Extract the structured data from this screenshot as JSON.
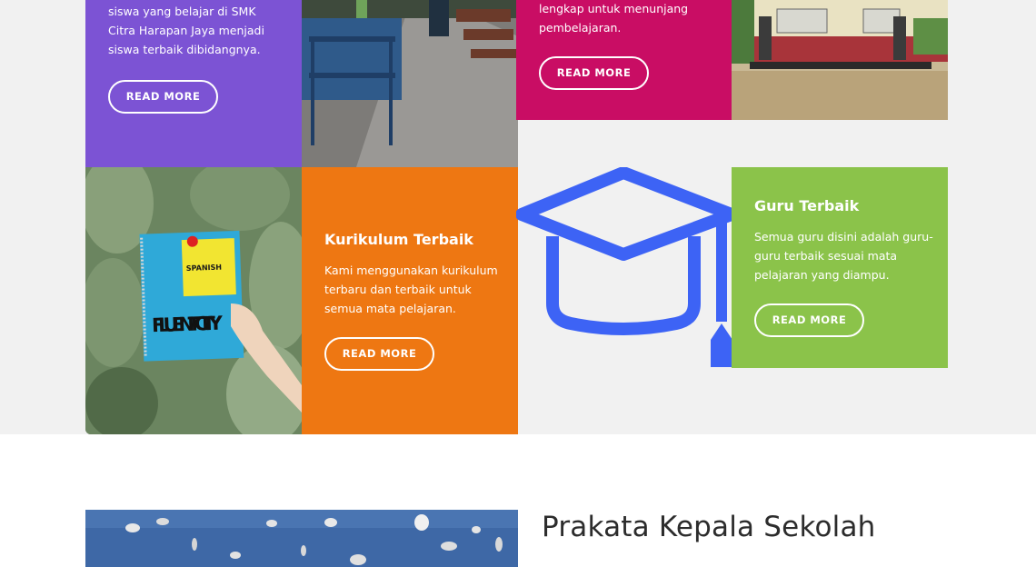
{
  "cards": {
    "prestasi": {
      "text": "siswa yang belajar di SMK Citra Harapan Jaya menjadi siswa terbaik dibidangnya.",
      "button": "READ MORE"
    },
    "fasilitas": {
      "text": "lengkap untuk menunjang pembelajaran.",
      "button": "READ MORE"
    },
    "kurikulum": {
      "title": "Kurikulum Terbaik",
      "text": "Kami menggunakan kurikulum terbaru dan terbaik untuk semua mata pelajaran.",
      "button": "READ MORE"
    },
    "guru": {
      "title": "Guru Terbaik",
      "text": "Semua guru disini adalah guru-guru terbaik sesuai mata pelajaran yang diampu.",
      "button": "READ MORE"
    }
  },
  "book": {
    "cover_small": "SPANISH",
    "cover_big": "FLUENT CITY"
  },
  "icons": {
    "graduation": "graduation-cap-icon"
  },
  "colors": {
    "purple": "#7c53d4",
    "magenta": "#c90d64",
    "orange": "#ee7712",
    "green": "#8bc34a",
    "icon_blue": "#3d63f5"
  },
  "section": {
    "heading": "Prakata Kepala Sekolah"
  }
}
